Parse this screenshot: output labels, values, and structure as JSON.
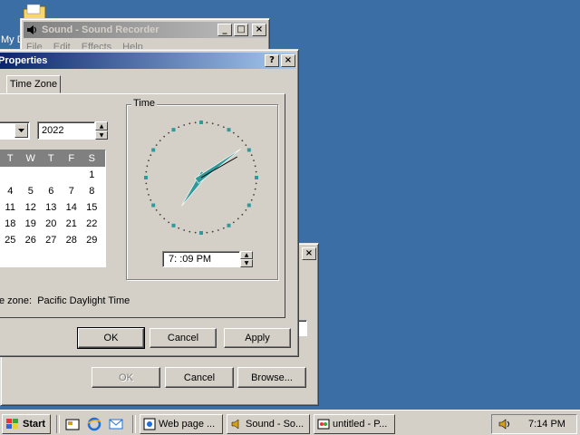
{
  "desktop": {
    "icon_label": "My D"
  },
  "sound_recorder": {
    "title": "Sound - Sound Recorder",
    "menu": [
      "File",
      "Edit",
      "Effects",
      "Help"
    ]
  },
  "browse_dialog": {
    "ok_label": "OK",
    "cancel_label": "Cancel",
    "browse_label": "Browse..."
  },
  "datetime": {
    "title": "Properties",
    "help_btn": "?",
    "close_btn": "×",
    "tab_time_zone": "Time Zone",
    "year": "2022",
    "weekdays": [
      "T",
      "W",
      "T",
      "F",
      "S"
    ],
    "weeks": [
      [
        "",
        "",
        "",
        "",
        "1"
      ],
      [
        "4",
        "5",
        "6",
        "7",
        "8"
      ],
      [
        "11",
        "12",
        "13",
        "14",
        "15"
      ],
      [
        "18",
        "19",
        "20",
        "21",
        "22"
      ],
      [
        "25",
        "26",
        "27",
        "28",
        "29"
      ]
    ],
    "time_group_label": "Time",
    "time_value": "7: :09 PM",
    "clock": {
      "hour": 7,
      "minute": 9,
      "second": 10
    },
    "timezone_text": "e zone:  Pacific Daylight Time",
    "ok_label": "OK",
    "cancel_label": "Cancel",
    "apply_label": "Apply"
  },
  "taskbar": {
    "start_label": "Start",
    "tasks": [
      {
        "label": "Web page ..."
      },
      {
        "label": "Sound - So..."
      },
      {
        "label": "untitled - P..."
      }
    ],
    "clock": "7:14 PM"
  },
  "colors": {
    "accent": "#0a246a",
    "desktop": "#3a6ea5",
    "clock_teal": "#2f9a9a"
  }
}
